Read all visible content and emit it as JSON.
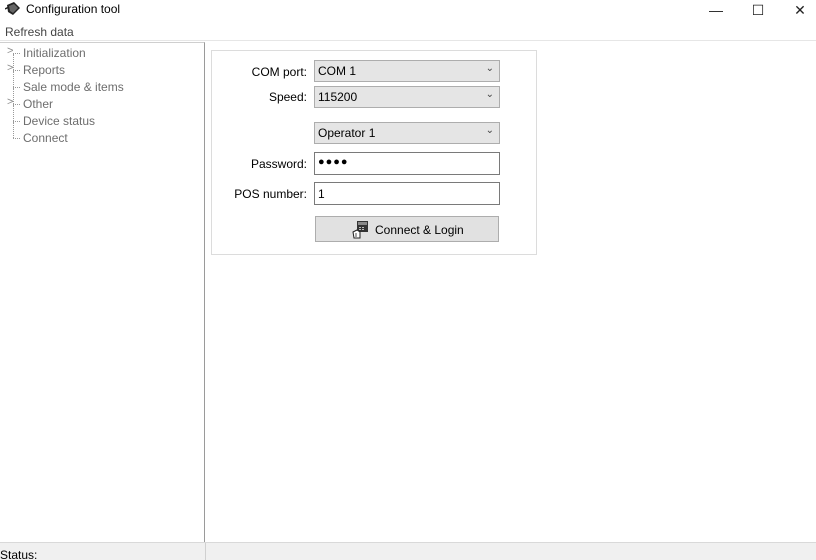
{
  "window": {
    "title": "Configuration tool",
    "minimize_glyph": "—",
    "maximize_glyph": "☐",
    "close_glyph": "✕"
  },
  "menu": {
    "refresh_label": "Refresh data"
  },
  "tree": {
    "items": [
      {
        "label": "Initialization",
        "expandable": true
      },
      {
        "label": "Reports",
        "expandable": true
      },
      {
        "label": "Sale mode & items",
        "expandable": false
      },
      {
        "label": "Other",
        "expandable": true
      },
      {
        "label": "Device status",
        "expandable": false
      },
      {
        "label": "Connect",
        "expandable": false
      }
    ],
    "expander_glyph": ">"
  },
  "form": {
    "com_port": {
      "label": "COM port:",
      "value": "COM 1"
    },
    "speed": {
      "label": "Speed:",
      "value": "115200"
    },
    "operator": {
      "value": "Operator 1"
    },
    "password": {
      "label": "Password:",
      "value": "●●●●"
    },
    "pos_number": {
      "label": "POS number:",
      "value": "1"
    },
    "connect_button": {
      "label": "Connect & Login",
      "icon": "card-reader-icon"
    }
  },
  "statusbar": {
    "label": "Status:"
  },
  "colors": {
    "combo_bg": "#e5e5e5",
    "button_bg": "#e1e1e1",
    "tree_text": "#6d6d6d"
  }
}
